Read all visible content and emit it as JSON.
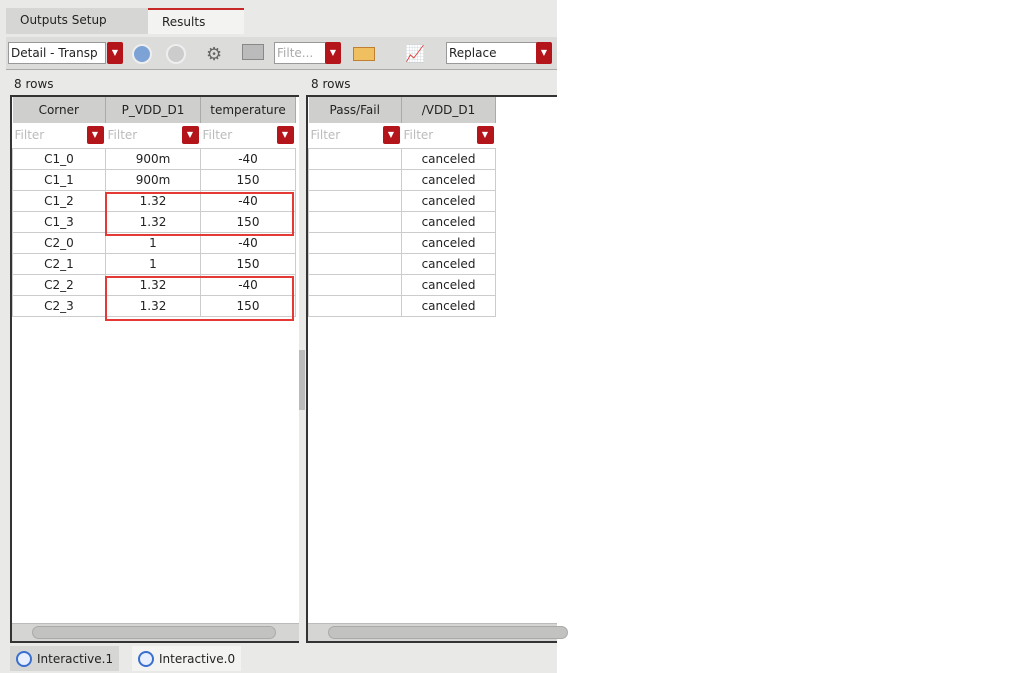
{
  "tabs": [
    {
      "label": "Outputs Setup",
      "active": false
    },
    {
      "label": "Results",
      "active": true
    }
  ],
  "toolbar": {
    "view_select": "Detail - Transp",
    "filter_placeholder": "Filte...",
    "plot_mode": "Replace",
    "icons": [
      "back-icon",
      "forward-icon",
      "settings-icon",
      "table-icon",
      "toggle-icon",
      "plot-icon"
    ]
  },
  "left": {
    "row_count": "8 rows",
    "columns": [
      "Corner",
      "P_VDD_D1",
      "temperature"
    ],
    "filter_placeholder": "Filter",
    "rows": [
      [
        "C1_0",
        "900m",
        "-40"
      ],
      [
        "C1_1",
        "900m",
        "150"
      ],
      [
        "C1_2",
        "1.32",
        "-40"
      ],
      [
        "C1_3",
        "1.32",
        "150"
      ],
      [
        "C2_0",
        "1",
        "-40"
      ],
      [
        "C2_1",
        "1",
        "150"
      ],
      [
        "C2_2",
        "1.32",
        "-40"
      ],
      [
        "C2_3",
        "1.32",
        "150"
      ]
    ]
  },
  "right": {
    "row_count": "8 rows",
    "columns": [
      "Pass/Fail",
      "/VDD_D1"
    ],
    "filter_placeholder": "Filter",
    "rows": [
      [
        "",
        "canceled"
      ],
      [
        "",
        "canceled"
      ],
      [
        "",
        "canceled"
      ],
      [
        "",
        "canceled"
      ],
      [
        "",
        "canceled"
      ],
      [
        "",
        "canceled"
      ],
      [
        "",
        "canceled"
      ],
      [
        "",
        "canceled"
      ]
    ]
  },
  "bottom_tabs": [
    "Interactive.1",
    "Interactive.0"
  ],
  "colors": {
    "accent": "#b3151b",
    "highlight": "#e53935"
  }
}
